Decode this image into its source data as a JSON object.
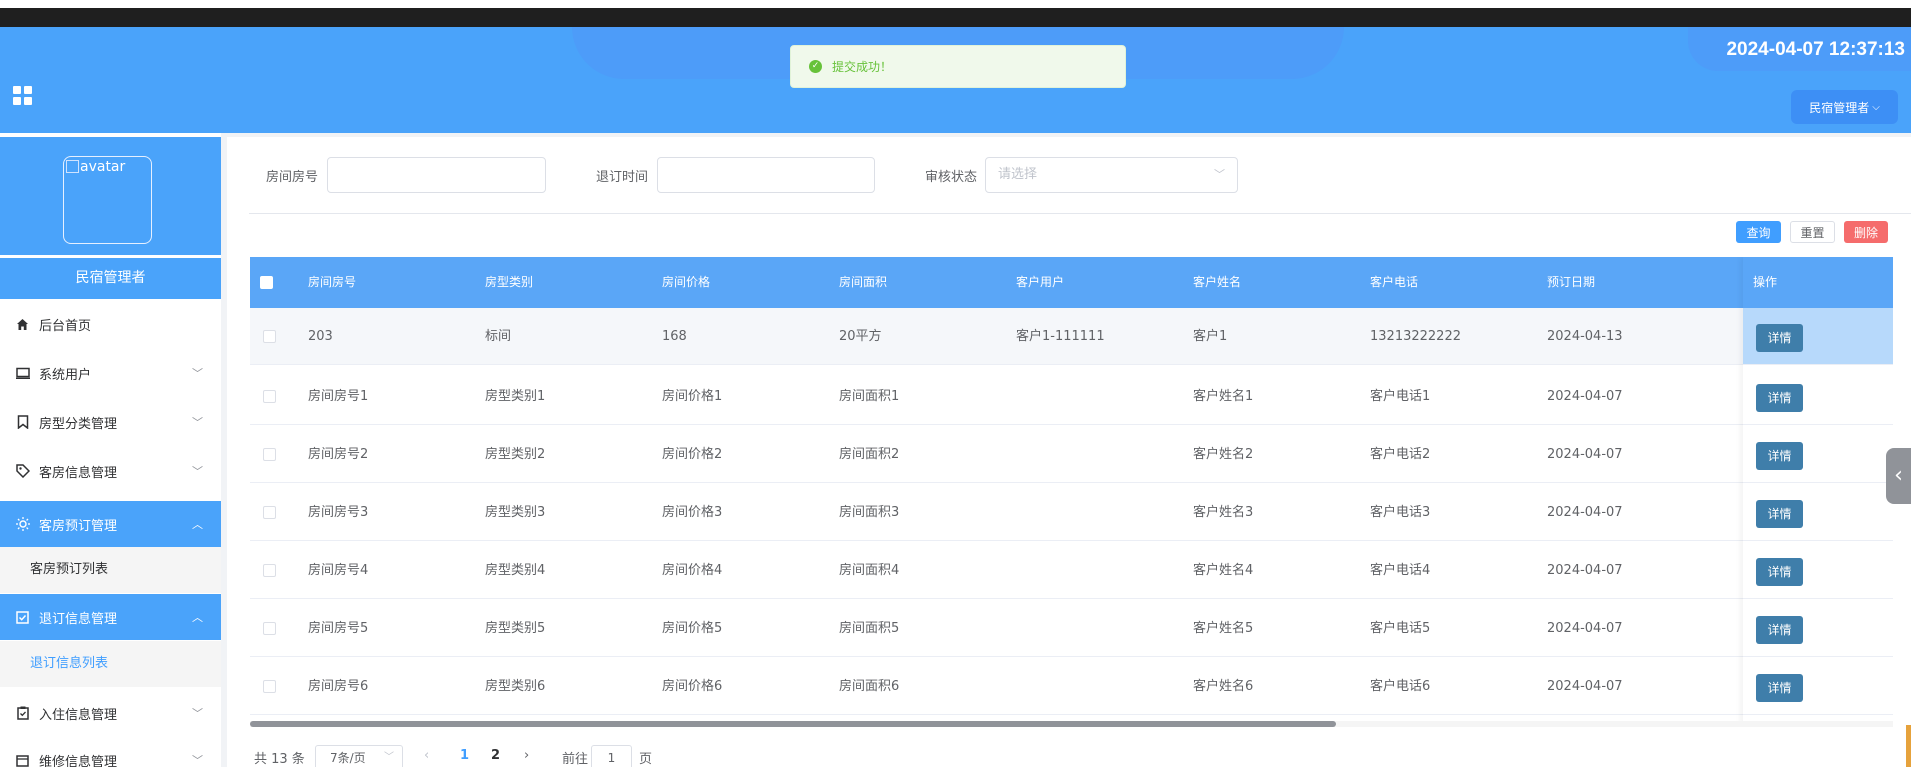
{
  "header": {
    "datetime": "2024-04-07 12:37:13",
    "user_menu": "民宿管理者",
    "accent": "#4aa3fa"
  },
  "toast": {
    "message": "提交成功！",
    "color": "#67c23a"
  },
  "sidebar": {
    "avatar_alt": "avatar",
    "role": "民宿管理者",
    "items": [
      {
        "label": "后台首页",
        "icon": "home-icon"
      },
      {
        "label": "系统用户",
        "icon": "monitor-icon"
      },
      {
        "label": "房型分类管理",
        "icon": "bookmark-icon"
      },
      {
        "label": "客房信息管理",
        "icon": "tag-icon"
      },
      {
        "label": "客房预订管理",
        "icon": "sun-icon",
        "active": true
      },
      {
        "label": "客房预订列表",
        "sub": true
      },
      {
        "label": "退订信息管理",
        "icon": "checkbox-icon",
        "active": true
      },
      {
        "label": "退订信息列表",
        "sub": true,
        "current": true
      },
      {
        "label": "入住信息管理",
        "icon": "clipboard-icon"
      },
      {
        "label": "维修信息管理",
        "icon": "calendar-icon"
      }
    ]
  },
  "search": {
    "room_label": "房间房号",
    "cancel_time_label": "退订时间",
    "status_label": "审核状态",
    "status_placeholder": "请选择"
  },
  "actions": {
    "query": "查询",
    "reset": "重置",
    "delete": "删除"
  },
  "table": {
    "columns": [
      "房间房号",
      "房型类别",
      "房间价格",
      "房间面积",
      "客户用户",
      "客户姓名",
      "客户电话",
      "预订日期",
      "操作"
    ],
    "rows": [
      [
        "203",
        "标间",
        "168",
        "20平方",
        "客户1-111111",
        "客户1",
        "13213222222",
        "2024-04-13"
      ],
      [
        "房间房号1",
        "房型类别1",
        "房间价格1",
        "房间面积1",
        "",
        "客户姓名1",
        "客户电话1",
        "2024-04-07"
      ],
      [
        "房间房号2",
        "房型类别2",
        "房间价格2",
        "房间面积2",
        "",
        "客户姓名2",
        "客户电话2",
        "2024-04-07"
      ],
      [
        "房间房号3",
        "房型类别3",
        "房间价格3",
        "房间面积3",
        "",
        "客户姓名3",
        "客户电话3",
        "2024-04-07"
      ],
      [
        "房间房号4",
        "房型类别4",
        "房间价格4",
        "房间面积4",
        "",
        "客户姓名4",
        "客户电话4",
        "2024-04-07"
      ],
      [
        "房间房号5",
        "房型类别5",
        "房间价格5",
        "房间面积5",
        "",
        "客户姓名5",
        "客户电话5",
        "2024-04-07"
      ],
      [
        "房间房号6",
        "房型类别6",
        "房间价格6",
        "房间面积6",
        "",
        "客户姓名6",
        "客户电话6",
        "2024-04-07"
      ]
    ],
    "detail_label": "详情"
  },
  "pagination": {
    "total": "共 13 条",
    "page_size": "7条/页",
    "pages": [
      "1",
      "2"
    ],
    "current_page": "1",
    "goto_prefix": "前往",
    "goto_value": "1",
    "goto_suffix": "页"
  }
}
